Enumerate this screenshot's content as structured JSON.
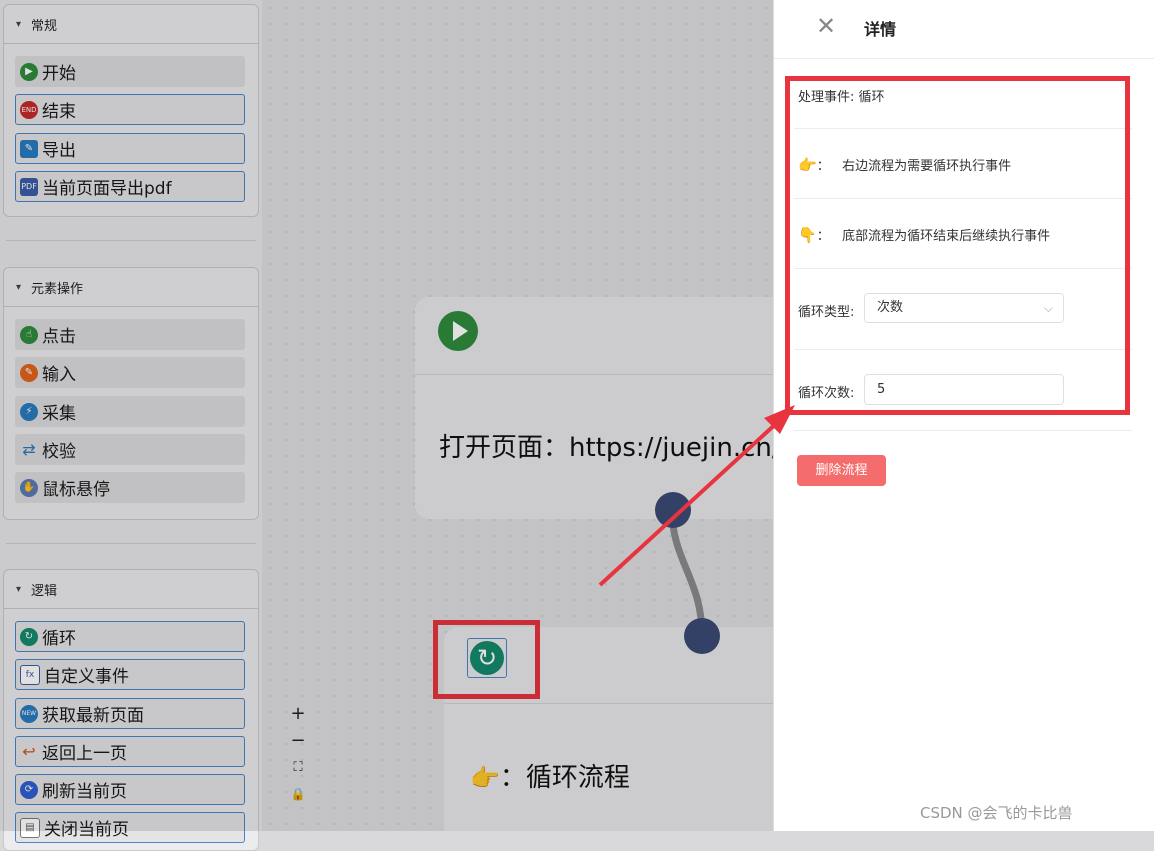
{
  "palette": {
    "groups": [
      {
        "title": "常规",
        "items": [
          "开始",
          "结束",
          "导出",
          "当前页面导出pdf"
        ]
      },
      {
        "title": "元素操作",
        "items": [
          "点击",
          "输入",
          "采集",
          "校验",
          "鼠标悬停"
        ]
      },
      {
        "title": "逻辑",
        "items": [
          "循环",
          "自定义事件",
          "获取最新页面",
          "返回上一页",
          "刷新当前页",
          "关闭当前页"
        ]
      }
    ]
  },
  "canvas": {
    "node_open": "打开页面：https://juejin.cn/",
    "node_loop": "：循环流程",
    "zoom": [
      "+",
      "−",
      "⛶",
      "🔒"
    ]
  },
  "drawer": {
    "title": "详情",
    "event_label": "处理事件:",
    "event_value": "循环",
    "right_hint_sep": "：",
    "right_hint": "右边流程为需要循环执行事件",
    "bottom_hint_sep": "：",
    "bottom_hint": "底部流程为循环结束后继续执行事件",
    "loop_type_label": "循环类型:",
    "loop_type_value": "次数",
    "loop_count_label": "循环次数:",
    "loop_count_value": "5",
    "delete_button": "删除流程",
    "watermark": "CSDN @会飞的卡比兽"
  },
  "colors": {
    "accent_red": "#e8343f",
    "delete": "#f56c6c",
    "node_dot": "#3a4a73",
    "loop_green": "#138a6e"
  }
}
